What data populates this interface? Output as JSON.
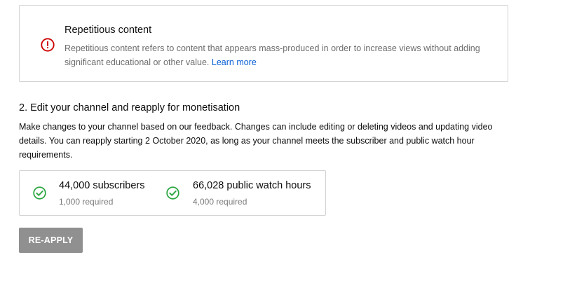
{
  "issue": {
    "icon": "alert-circle-icon",
    "title": "Repetitious content",
    "description": "Repetitious content refers to content that appears mass-produced in order to increase views without adding significant educational or other value.",
    "learn_more": "Learn more"
  },
  "step": {
    "heading": "2. Edit your channel and reapply for monetisation",
    "description": "Make changes to your channel based on our feedback. Changes can include editing or deleting videos and updating video details. You can reapply starting 2 October 2020, as long as your channel meets the subscriber and public watch hour requirements."
  },
  "requirements": [
    {
      "icon": "check-circle-icon",
      "value": "44,000 subscribers",
      "required": "1,000 required"
    },
    {
      "icon": "check-circle-icon",
      "value": "66,028 public watch hours",
      "required": "4,000 required"
    }
  ],
  "button": {
    "label": "RE-APPLY"
  },
  "colors": {
    "error_red": "#cc0000",
    "success_green": "#2ba640",
    "link_blue": "#065fd4",
    "button_disabled": "#909090"
  }
}
